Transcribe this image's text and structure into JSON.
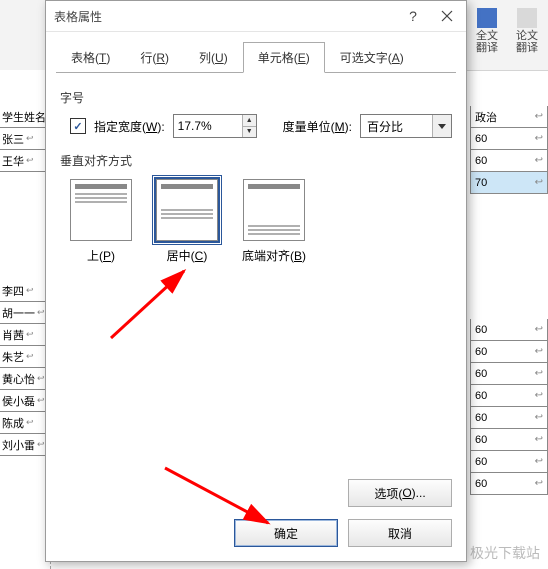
{
  "ribbon": {
    "buttons": [
      {
        "label": "全文\n翻译"
      },
      {
        "label": "论文\n翻译"
      },
      {
        "label": "论文"
      }
    ]
  },
  "bg_left": {
    "header": "学生姓名",
    "rows1": [
      "张三",
      "王华"
    ],
    "rows2": [
      "李四",
      "胡一一",
      "肖茜",
      "朱艺",
      "黄心怡",
      "侯小磊",
      "陈成",
      "刘小雷"
    ]
  },
  "bg_right": {
    "header": "政治",
    "vals1": [
      "60",
      "60",
      "70"
    ],
    "vals2": [
      "60",
      "60",
      "60",
      "60",
      "60",
      "60",
      "60",
      "60"
    ]
  },
  "dialog": {
    "title": "表格属性",
    "help": "?",
    "tabs": {
      "table": "表格(T)",
      "row": "行(R)",
      "column": "列(U)",
      "cell": "单元格(E)",
      "alt": "可选文字(A)"
    },
    "size_label": "字号",
    "width_check": "指定宽度(W):",
    "width_value": "17.7%",
    "unit_label": "度量单位(M):",
    "unit_value": "百分比",
    "valign_label": "垂直对齐方式",
    "align": {
      "top": "上(P)",
      "center": "居中(C)",
      "bottom": "底端对齐(B)"
    },
    "options_btn": "选项(O)...",
    "ok": "确定",
    "cancel": "取消"
  },
  "watermark": "极光下载站"
}
